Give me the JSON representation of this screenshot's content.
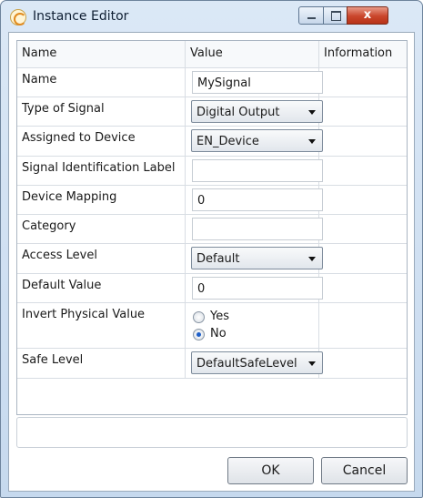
{
  "window": {
    "title": "Instance Editor",
    "close_glyph": "x"
  },
  "grid": {
    "headers": {
      "name": "Name",
      "value": "Value",
      "info": "Information"
    },
    "rows": [
      {
        "label": "Name",
        "value": "MySignal"
      },
      {
        "label": "Type of Signal",
        "value": "Digital Output"
      },
      {
        "label": "Assigned to Device",
        "value": "EN_Device"
      },
      {
        "label": "Signal Identification Label",
        "value": ""
      },
      {
        "label": "Device Mapping",
        "value": "0"
      },
      {
        "label": "Category",
        "value": ""
      },
      {
        "label": "Access Level",
        "value": "Default"
      },
      {
        "label": "Default Value",
        "value": "0"
      },
      {
        "label": "Invert Physical Value",
        "options": [
          "Yes",
          "No"
        ],
        "selected": "No"
      },
      {
        "label": "Safe Level",
        "value": "DefaultSafeLevel"
      }
    ]
  },
  "buttons": {
    "ok": "OK",
    "cancel": "Cancel"
  },
  "icons": {
    "app": "instance-editor-icon",
    "minimize": "minimize-icon",
    "maximize": "maximize-icon",
    "close": "close-icon",
    "dropdown": "chevron-down-icon"
  }
}
